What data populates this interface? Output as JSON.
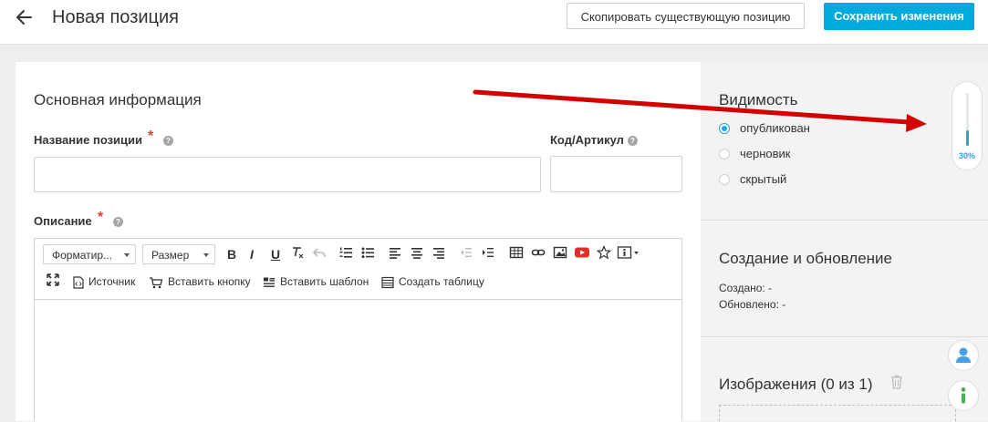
{
  "header": {
    "title": "Новая позиция",
    "copy_button": "Скопировать существующую позицию",
    "save_button": "Сохранить изменения"
  },
  "main": {
    "section_title": "Основная информация",
    "name_label": "Название позиции",
    "name_required": "*",
    "code_label": "Код/Артикул",
    "description_label": "Описание",
    "description_required": "*",
    "help_glyph": "?",
    "editor": {
      "format_dropdown": "Форматир...",
      "size_dropdown": "Размер",
      "bold": "B",
      "italic": "I",
      "underline": "U",
      "source": "Источник",
      "insert_button": "Вставить кнопку",
      "insert_template": "Вставить шаблон",
      "create_table": "Создать таблицу"
    }
  },
  "sidebar": {
    "visibility_title": "Видимость",
    "visibility_options": [
      {
        "label": "опубликован",
        "checked": true
      },
      {
        "label": "черновик",
        "checked": false
      },
      {
        "label": "скрытый",
        "checked": false
      }
    ],
    "created_title": "Создание и обновление",
    "created_label": "Создано: -",
    "updated_label": "Обновлено: -",
    "images_title": "Изображения (0 из 1)"
  },
  "progress": {
    "label": "30%",
    "fraction": 0.3
  },
  "colors": {
    "accent": "#00aadd",
    "required": "#e53935",
    "annotation_arrow": "#d40000"
  }
}
